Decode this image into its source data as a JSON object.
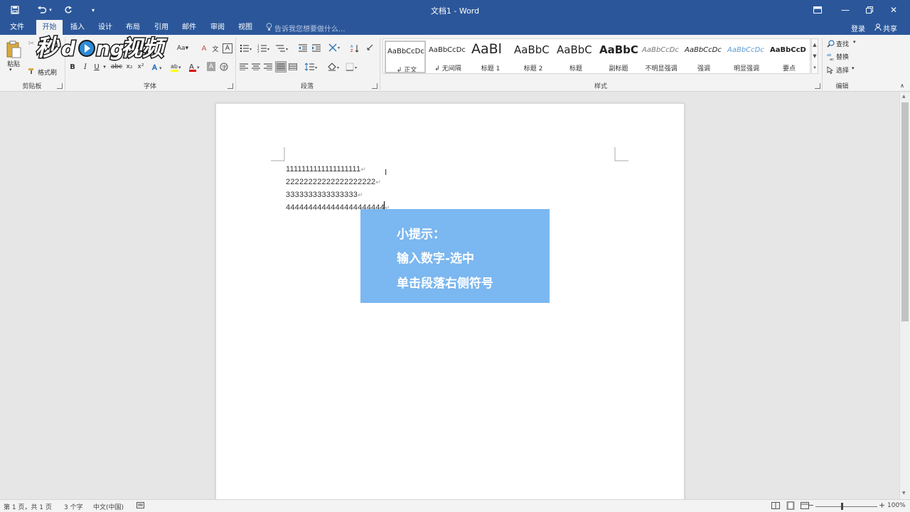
{
  "window": {
    "title": "文档1 - Word"
  },
  "tabs": [
    {
      "label": "文件"
    },
    {
      "label": "开始"
    },
    {
      "label": "插入"
    },
    {
      "label": "设计"
    },
    {
      "label": "布局"
    },
    {
      "label": "引用"
    },
    {
      "label": "邮件"
    },
    {
      "label": "审阅"
    },
    {
      "label": "视图"
    }
  ],
  "tell_me": {
    "placeholder": "告诉我您想要做什么..."
  },
  "account": {
    "login": "登录",
    "share": "共享"
  },
  "ribbon": {
    "clipboard": {
      "label": "剪贴板",
      "paste": "粘贴",
      "format_painter": "格式刷"
    },
    "font": {
      "label": "字体",
      "bold": "B",
      "italic": "I",
      "underline": "U",
      "strike": "abc",
      "sub": "x₂",
      "sup": "x²",
      "font_color": "A",
      "clear": "Aa"
    },
    "paragraph": {
      "label": "段落"
    },
    "styles": {
      "label": "样式",
      "items": [
        {
          "preview": "AaBbCcDc",
          "name": "↲ 正文"
        },
        {
          "preview": "AaBbCcDc",
          "name": "↲ 无间隔"
        },
        {
          "preview": "AaBl",
          "name": "标题 1"
        },
        {
          "preview": "AaBbC",
          "name": "标题 2"
        },
        {
          "preview": "AaBbC",
          "name": "标题"
        },
        {
          "preview": "AaBbC",
          "name": "副标题"
        },
        {
          "preview": "AaBbCcDc",
          "name": "不明显强调"
        },
        {
          "preview": "AaBbCcDc",
          "name": "强调"
        },
        {
          "preview": "AaBbCcDc",
          "name": "明显强调"
        },
        {
          "preview": "AaBbCcD",
          "name": "要点"
        }
      ]
    },
    "editing": {
      "label": "编辑",
      "find": "查找",
      "replace": "替换",
      "select": "选择"
    }
  },
  "watermark": {
    "text": "秒懂视频"
  },
  "document": {
    "lines": [
      "1111111111111111111",
      "22222222222222222222",
      "3333333333333333",
      "4444444444444444444444"
    ],
    "para_mark": "↵"
  },
  "tip": {
    "lines": [
      "小提示：",
      "输入数字-选中",
      "单击段落右侧符号"
    ],
    "color": "#74b4f0"
  },
  "status": {
    "page": "第 1 页，共 1 页",
    "words": "3 个字",
    "lang": "中文(中国)",
    "zoom": "100%"
  }
}
